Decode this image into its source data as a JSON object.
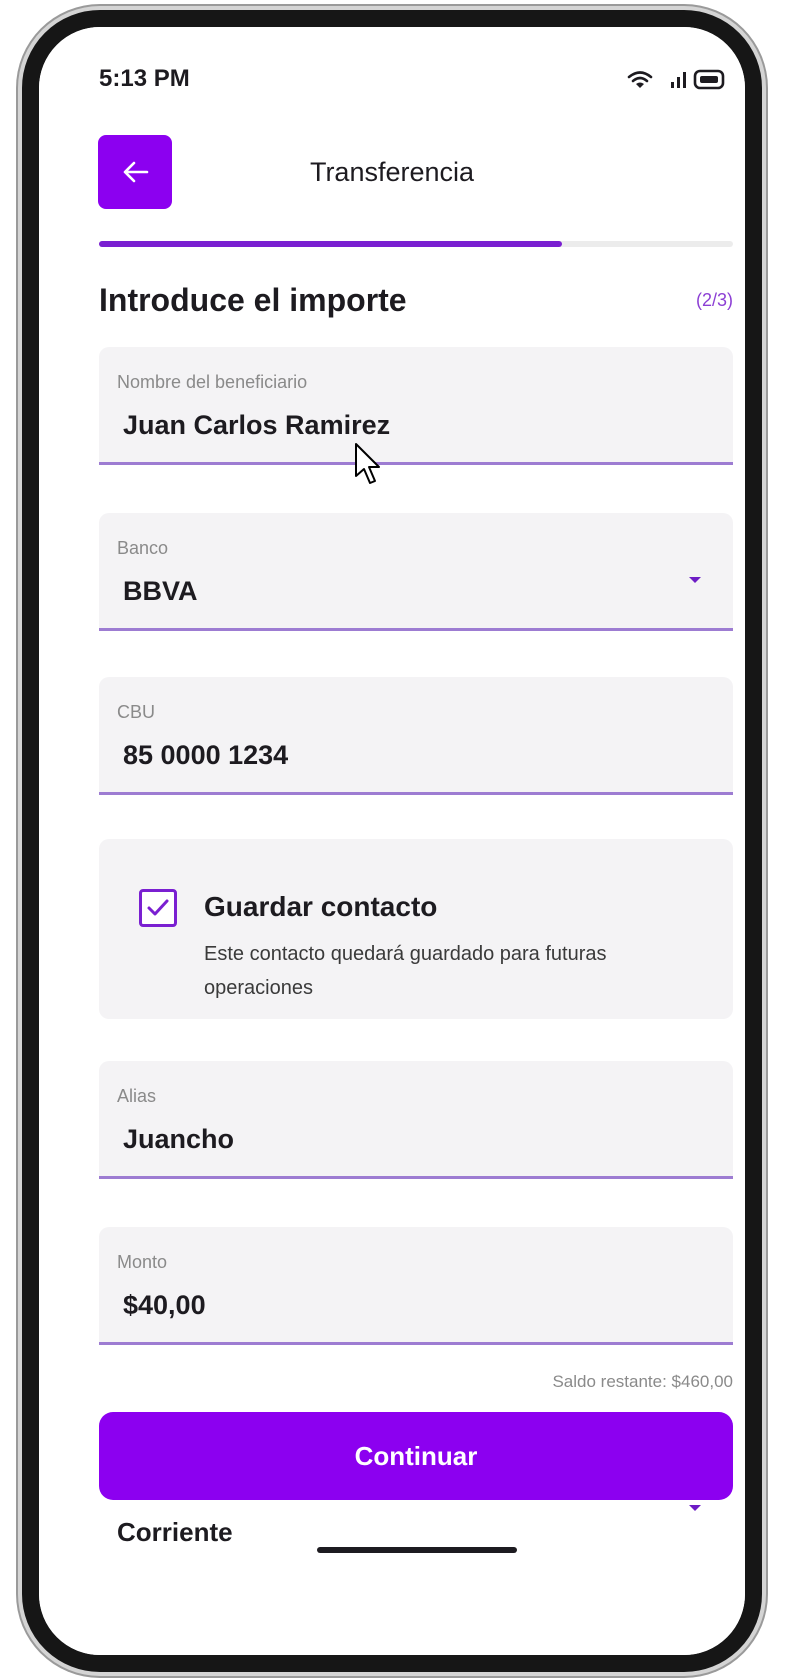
{
  "status_bar": {
    "time": "5:13 PM"
  },
  "header": {
    "title": "Transferencia"
  },
  "progress": {
    "value": 0.73
  },
  "section": {
    "title": "Introduce el importe",
    "step": "(2/3)"
  },
  "fields": {
    "beneficiary": {
      "label": "Nombre del beneficiario",
      "value": "Juan Carlos Ramirez"
    },
    "bank": {
      "label": "Banco",
      "value": "BBVA"
    },
    "cbu": {
      "label": "CBU",
      "value": "85 0000 1234"
    },
    "alias": {
      "label": "Alias",
      "value": "Juancho"
    },
    "amount": {
      "label": "Monto",
      "value": "$40,00"
    }
  },
  "save_contact": {
    "checked": true,
    "title": "Guardar contacto",
    "description": "Este contacto quedará guardado para futuras operaciones"
  },
  "balance": {
    "text": "Saldo restante:  $460,00"
  },
  "actions": {
    "continue_label": "Continuar"
  },
  "account_type": {
    "value": "Corriente"
  },
  "colors": {
    "accent": "#8c00f0",
    "underline": "#9d7cd2",
    "field_bg": "#f4f3f5"
  },
  "icons": {
    "back": "arrow-left-icon",
    "wifi": "wifi-icon",
    "signal": "signal-icon",
    "battery": "battery-icon",
    "cursor": "mouse-cursor-icon",
    "check": "check-icon"
  }
}
